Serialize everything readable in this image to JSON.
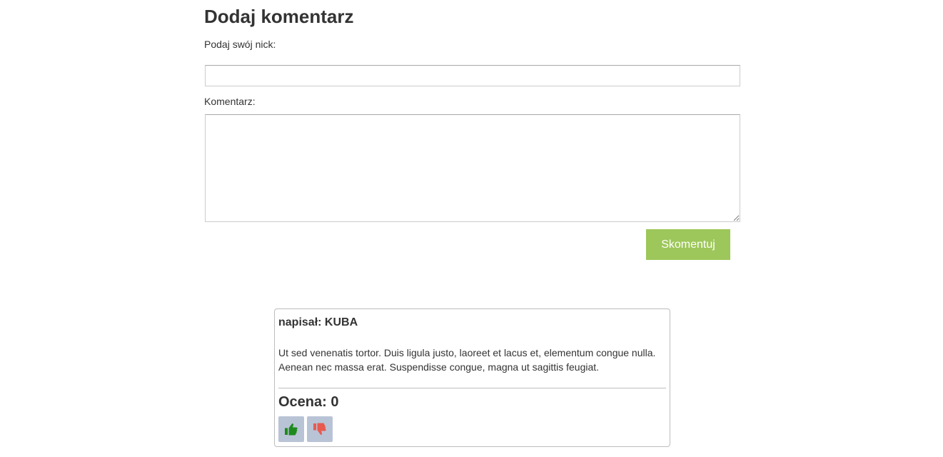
{
  "form": {
    "title": "Dodaj komentarz",
    "nick_label": "Podaj swój nick:",
    "nick_value": "",
    "comment_label": "Komentarz:",
    "comment_value": "",
    "submit_label": "Skomentuj"
  },
  "comment": {
    "author_line": "napisał: KUBA",
    "body_lines": [
      "Ut sed venenatis tortor. Duis ligula justo, laoreet et lacus et, elementum congue nulla.",
      "Aenean nec massa erat. Suspendisse congue, magna ut sagittis feugiat."
    ],
    "rating_line": "Ocena: 0",
    "vote_up_icon": "thumbs-up-icon",
    "vote_down_icon": "thumbs-down-icon"
  },
  "colors": {
    "accent_button": "#9dc75a",
    "vote_button_bg": "#b9c3d6",
    "thumbs_up": "#1e8a1e",
    "thumbs_down": "#e85a4f"
  }
}
